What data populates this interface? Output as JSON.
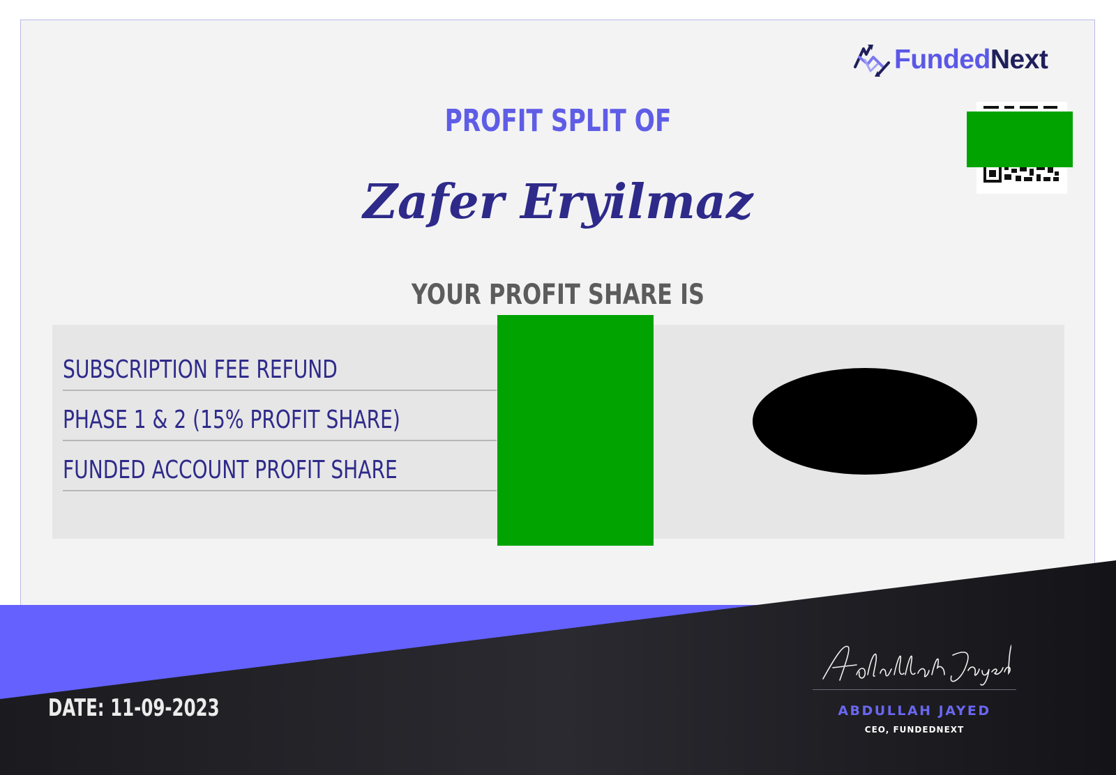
{
  "brand": {
    "name_part1": "Funded",
    "name_part2": "Next",
    "color_primary": "#5b58e6",
    "color_dark": "#1f1f5c"
  },
  "certificate": {
    "heading": "PROFIT SPLIT OF",
    "recipient": "Zafer Eryilmaz",
    "subheading": "YOUR PROFIT SHARE IS",
    "rows": [
      {
        "label": "SUBSCRIPTION FEE REFUND"
      },
      {
        "label": "PHASE 1 & 2 (15% PROFIT SHARE)"
      },
      {
        "label": "FUNDED ACCOUNT PROFIT SHARE"
      }
    ]
  },
  "footer": {
    "date": "DATE: 11-09-2023",
    "signatory_name": "ABDULLAH JAYED",
    "signatory_title": "CEO, FUNDEDNEXT",
    "signature_text": "Abdullah Jayed"
  },
  "colors": {
    "accent": "#6461ff",
    "footer_dark": "#141418",
    "redaction_green": "#00a300",
    "redaction_black": "#000000"
  }
}
